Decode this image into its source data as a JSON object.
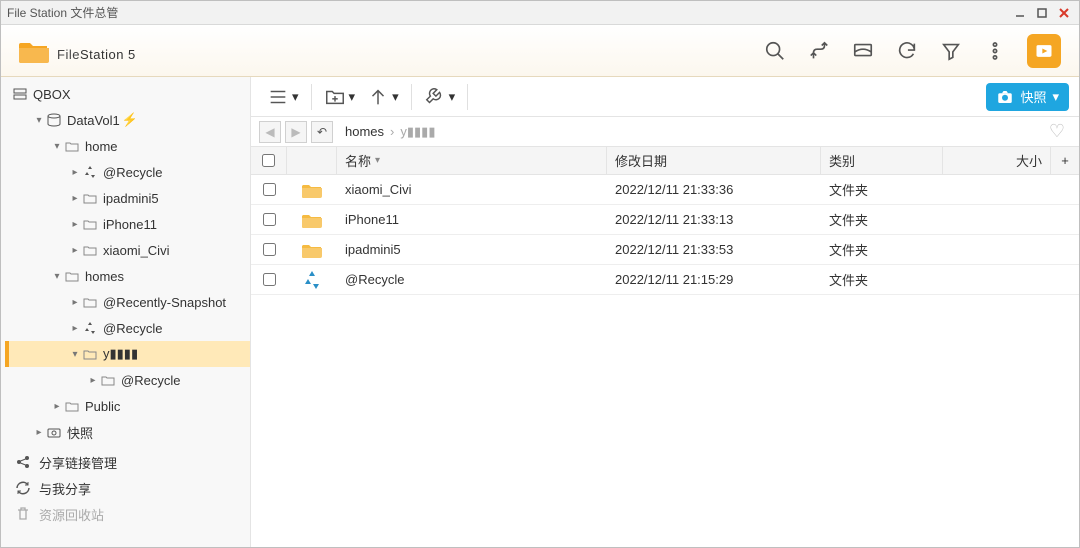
{
  "window": {
    "title": "File Station 文件总管"
  },
  "app": {
    "name_bold": "File",
    "name_light": "Station 5"
  },
  "toolbar": {
    "snapshot_label": "快照"
  },
  "path": {
    "crumb1": "homes",
    "crumb2": "y▮▮▮▮"
  },
  "columns": {
    "name": "名称",
    "date": "修改日期",
    "type": "类别",
    "size": "大小",
    "add": "+"
  },
  "rows": [
    {
      "name": "xiaomi_Civi",
      "date": "2022/12/11 21:33:36",
      "type": "文件夹",
      "icon": "folder"
    },
    {
      "name": "iPhone11",
      "date": "2022/12/11 21:33:13",
      "type": "文件夹",
      "icon": "folder"
    },
    {
      "name": "ipadmini5",
      "date": "2022/12/11 21:33:53",
      "type": "文件夹",
      "icon": "folder"
    },
    {
      "name": "@Recycle",
      "date": "2022/12/11 21:15:29",
      "type": "文件夹",
      "icon": "recycle"
    }
  ],
  "tree": {
    "root": "QBOX",
    "datavol": "DataVol1",
    "home": "home",
    "recycle": "@Recycle",
    "ipadmini5": "ipadmini5",
    "iphone11": "iPhone11",
    "xiaomi": "xiaomi_Civi",
    "homes": "homes",
    "recent_snap": "@Recently-Snapshot",
    "recycle2": "@Recycle",
    "y_user": "y▮▮▮▮",
    "recycle3": "@Recycle",
    "public": "Public",
    "snapshot": "快照"
  },
  "sidenav": {
    "share_link": "分享链接管理",
    "with_me": "与我分享",
    "trash": "资源回收站"
  }
}
